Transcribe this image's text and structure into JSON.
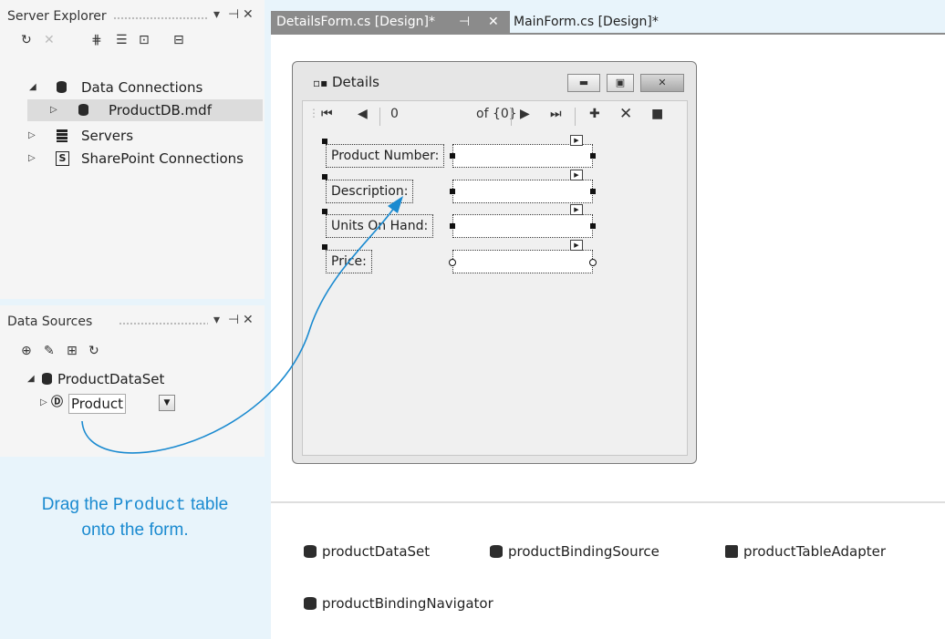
{
  "server_explorer": {
    "title": "Server Explorer",
    "pin": "✲",
    "close": "✕",
    "tree": [
      {
        "label": "Data Connections"
      },
      {
        "label": "ProductDB.mdf"
      },
      {
        "label": "Servers"
      },
      {
        "label": "SharePoint Connections"
      }
    ]
  },
  "data_sources": {
    "title": "Data Sources",
    "tree": [
      {
        "label": "ProductDataSet"
      },
      {
        "label": "Product"
      }
    ]
  },
  "tabs": {
    "active": "DetailsForm.cs [Design]*",
    "inactive": "MainForm.cs [Design]*"
  },
  "form": {
    "title": "Details",
    "navigator": {
      "position": "0",
      "count": "of {0}"
    },
    "fields": [
      {
        "label": "Product Number:"
      },
      {
        "label": "Description:"
      },
      {
        "label": "Units On Hand:"
      },
      {
        "label": "Price:"
      }
    ]
  },
  "component_tray": [
    {
      "label": "productDataSet"
    },
    {
      "label": "productBindingSource"
    },
    {
      "label": "productTableAdapter"
    },
    {
      "label": "productBindingNavigator"
    }
  ],
  "caption": {
    "before": "Drag the ",
    "code": "Product",
    "after": " table",
    "line2": "onto the form."
  },
  "colors": {
    "accent": "#1a8ad0",
    "background": "#e8f4fb",
    "active_tab": "#8b8b8b"
  }
}
